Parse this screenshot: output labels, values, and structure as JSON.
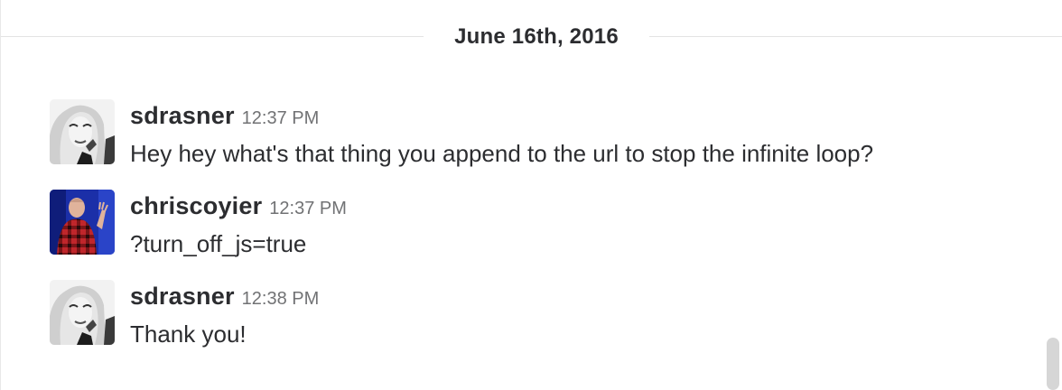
{
  "day_divider": {
    "label": "June 16th, 2016"
  },
  "messages": [
    {
      "author": "sdrasner",
      "time": "12:37 PM",
      "text": "Hey hey what's that thing you append to the url to stop the infinite loop?",
      "avatar_icon": "sdrasner-avatar"
    },
    {
      "author": "chriscoyier",
      "time": "12:37 PM",
      "text": "?turn_off_js=true",
      "avatar_icon": "chriscoyier-avatar"
    },
    {
      "author": "sdrasner",
      "time": "12:38 PM",
      "text": "Thank you!",
      "avatar_icon": "sdrasner-avatar"
    }
  ],
  "colors": {
    "text_primary": "#2c2d30",
    "text_secondary": "#717274",
    "divider": "#e3e3e3",
    "avatar_blue": "#1b2fa8",
    "avatar_red": "#c0262b"
  }
}
